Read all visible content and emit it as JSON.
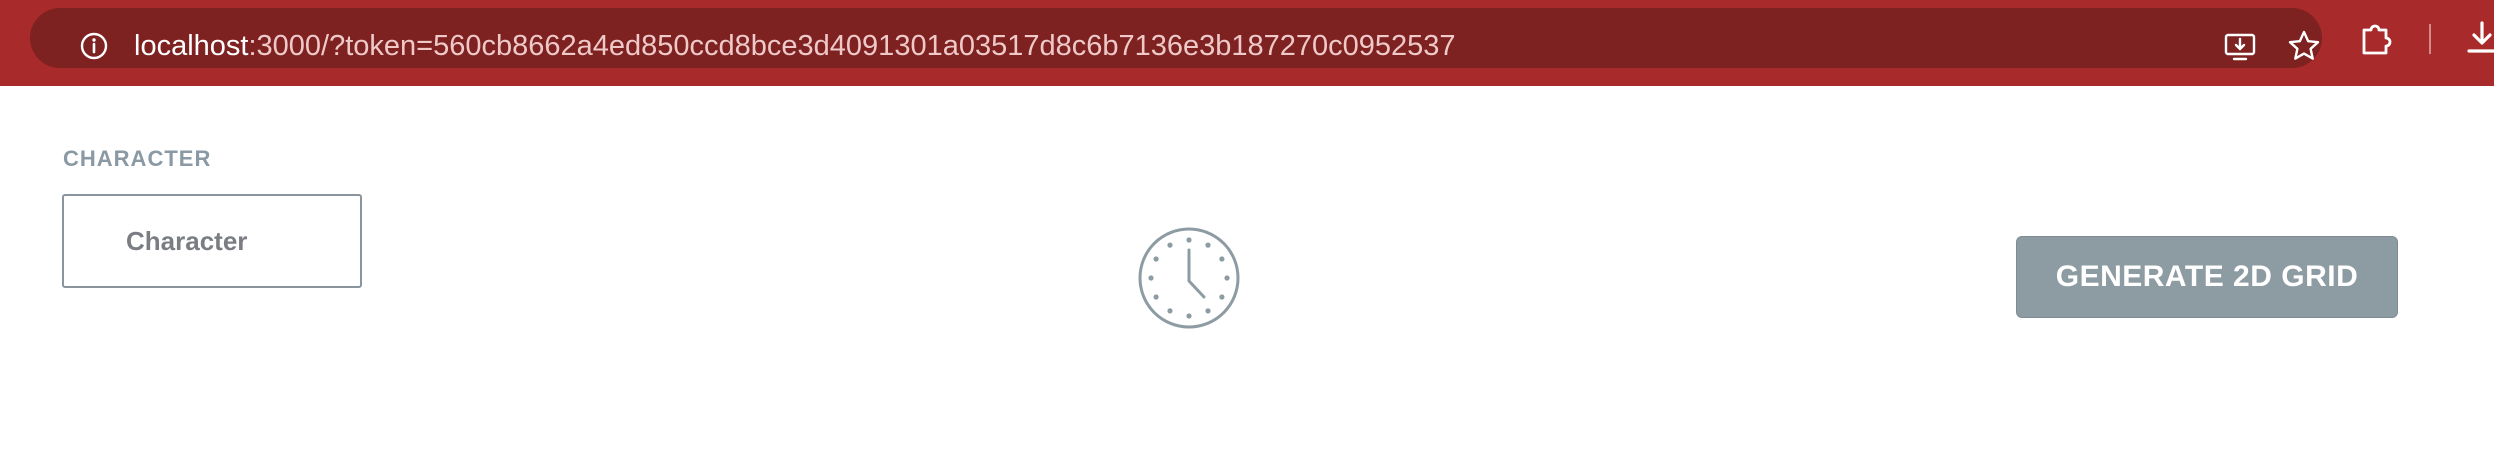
{
  "browser": {
    "url_host": "localhost",
    "url_rest": ":3000/?token=560cb8662a4ed850ccd8bce3d4091301a03517d8c6b7136e3b187270c0952537",
    "toolbar_icons": [
      "info-icon",
      "install-app-icon",
      "bookmark-star-icon",
      "extensions-icon",
      "download-icon"
    ],
    "colors": {
      "frame": "#a92a2a",
      "omnibox": "#7d2121"
    }
  },
  "main": {
    "character_label": "CHARACTER",
    "character_button_label": "Character",
    "status_icon": "clock-icon",
    "generate_button_label": "GENERATE 2D GRID",
    "colors": {
      "label": "#8a99a3",
      "button_disabled": "#8d9ba3"
    }
  }
}
